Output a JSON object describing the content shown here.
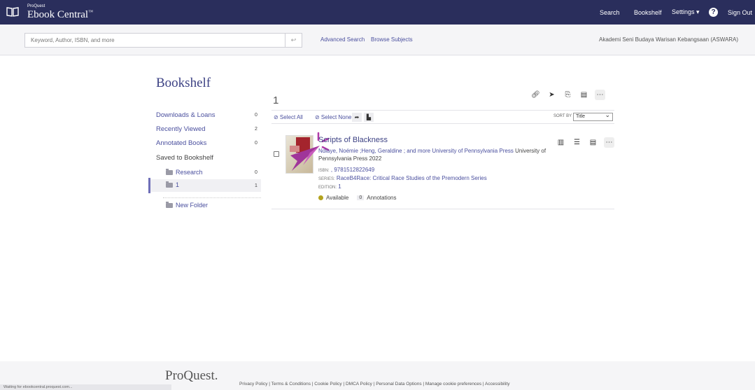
{
  "header": {
    "brand_small": "ProQuest",
    "brand_name": "Ebook Central",
    "brand_tm": "™",
    "nav": {
      "search": "Search",
      "bookshelf": "Bookshelf",
      "settings": "Settings ▾",
      "help": "?",
      "signout": "Sign Out"
    }
  },
  "search": {
    "placeholder": "Keyword, Author, ISBN, and more",
    "submit_icon": "↩",
    "advanced": "Advanced Search",
    "browse": "Browse Subjects",
    "institution": "Akademi Seni Budaya Warisan Kebangsaan (ASWARA)"
  },
  "sidebar": {
    "title": "Bookshelf",
    "items": [
      {
        "label": "Downloads & Loans",
        "count": "0"
      },
      {
        "label": "Recently Viewed",
        "count": "2"
      },
      {
        "label": "Annotated Books",
        "count": "0"
      },
      {
        "label": "Saved to Bookshelf"
      }
    ],
    "folders": [
      {
        "label": "Research",
        "count": "0"
      },
      {
        "label": "1",
        "count": "1"
      }
    ],
    "new_folder": "New Folder"
  },
  "results": {
    "folder_name": "1",
    "select_all": "⊘ Select All",
    "select_none": "⊘ Select None",
    "sort_by": "SORT BY",
    "sort_value": "Title"
  },
  "book": {
    "title": "Scripts of Blackness",
    "authors": "Ndiaye, Noémie ;Heng, Geraldine ; and more",
    "publisher_link": "University of Pennsylvania Press",
    "publisher_tail": "University of Pennsylvania Press",
    "year": "2022",
    "isbn_key": "ISBN:",
    "isbn": ", 9781512822649",
    "series_key": "SERIES:",
    "series": "RaceB4Race: Critical Race Studies of the Premodern Series",
    "edition_key": "EDITION:",
    "edition": "1",
    "availability": "Available",
    "annotations_count": "0",
    "annotations_label": "Annotations"
  },
  "footer": {
    "logo": "ProQuest.",
    "links": "Privacy Policy | Terms & Conditions | Cookie Policy | DMCA Policy | Personal Data Options | Manage cookie preferences | Accessibility"
  },
  "status": "Waiting for ebookcentral.proquest.com...",
  "colors": {
    "nav_bg": "#2a2e5c",
    "link": "#4a4f9e",
    "title": "#3d4284",
    "available": "#b3a31e"
  },
  "icons": [
    "book-open-icon",
    "link-icon",
    "send-icon",
    "export-icon",
    "comment-icon",
    "more-icon",
    "share-icon",
    "tag-icon",
    "read-icon",
    "list-icon",
    "cursor-icon"
  ]
}
